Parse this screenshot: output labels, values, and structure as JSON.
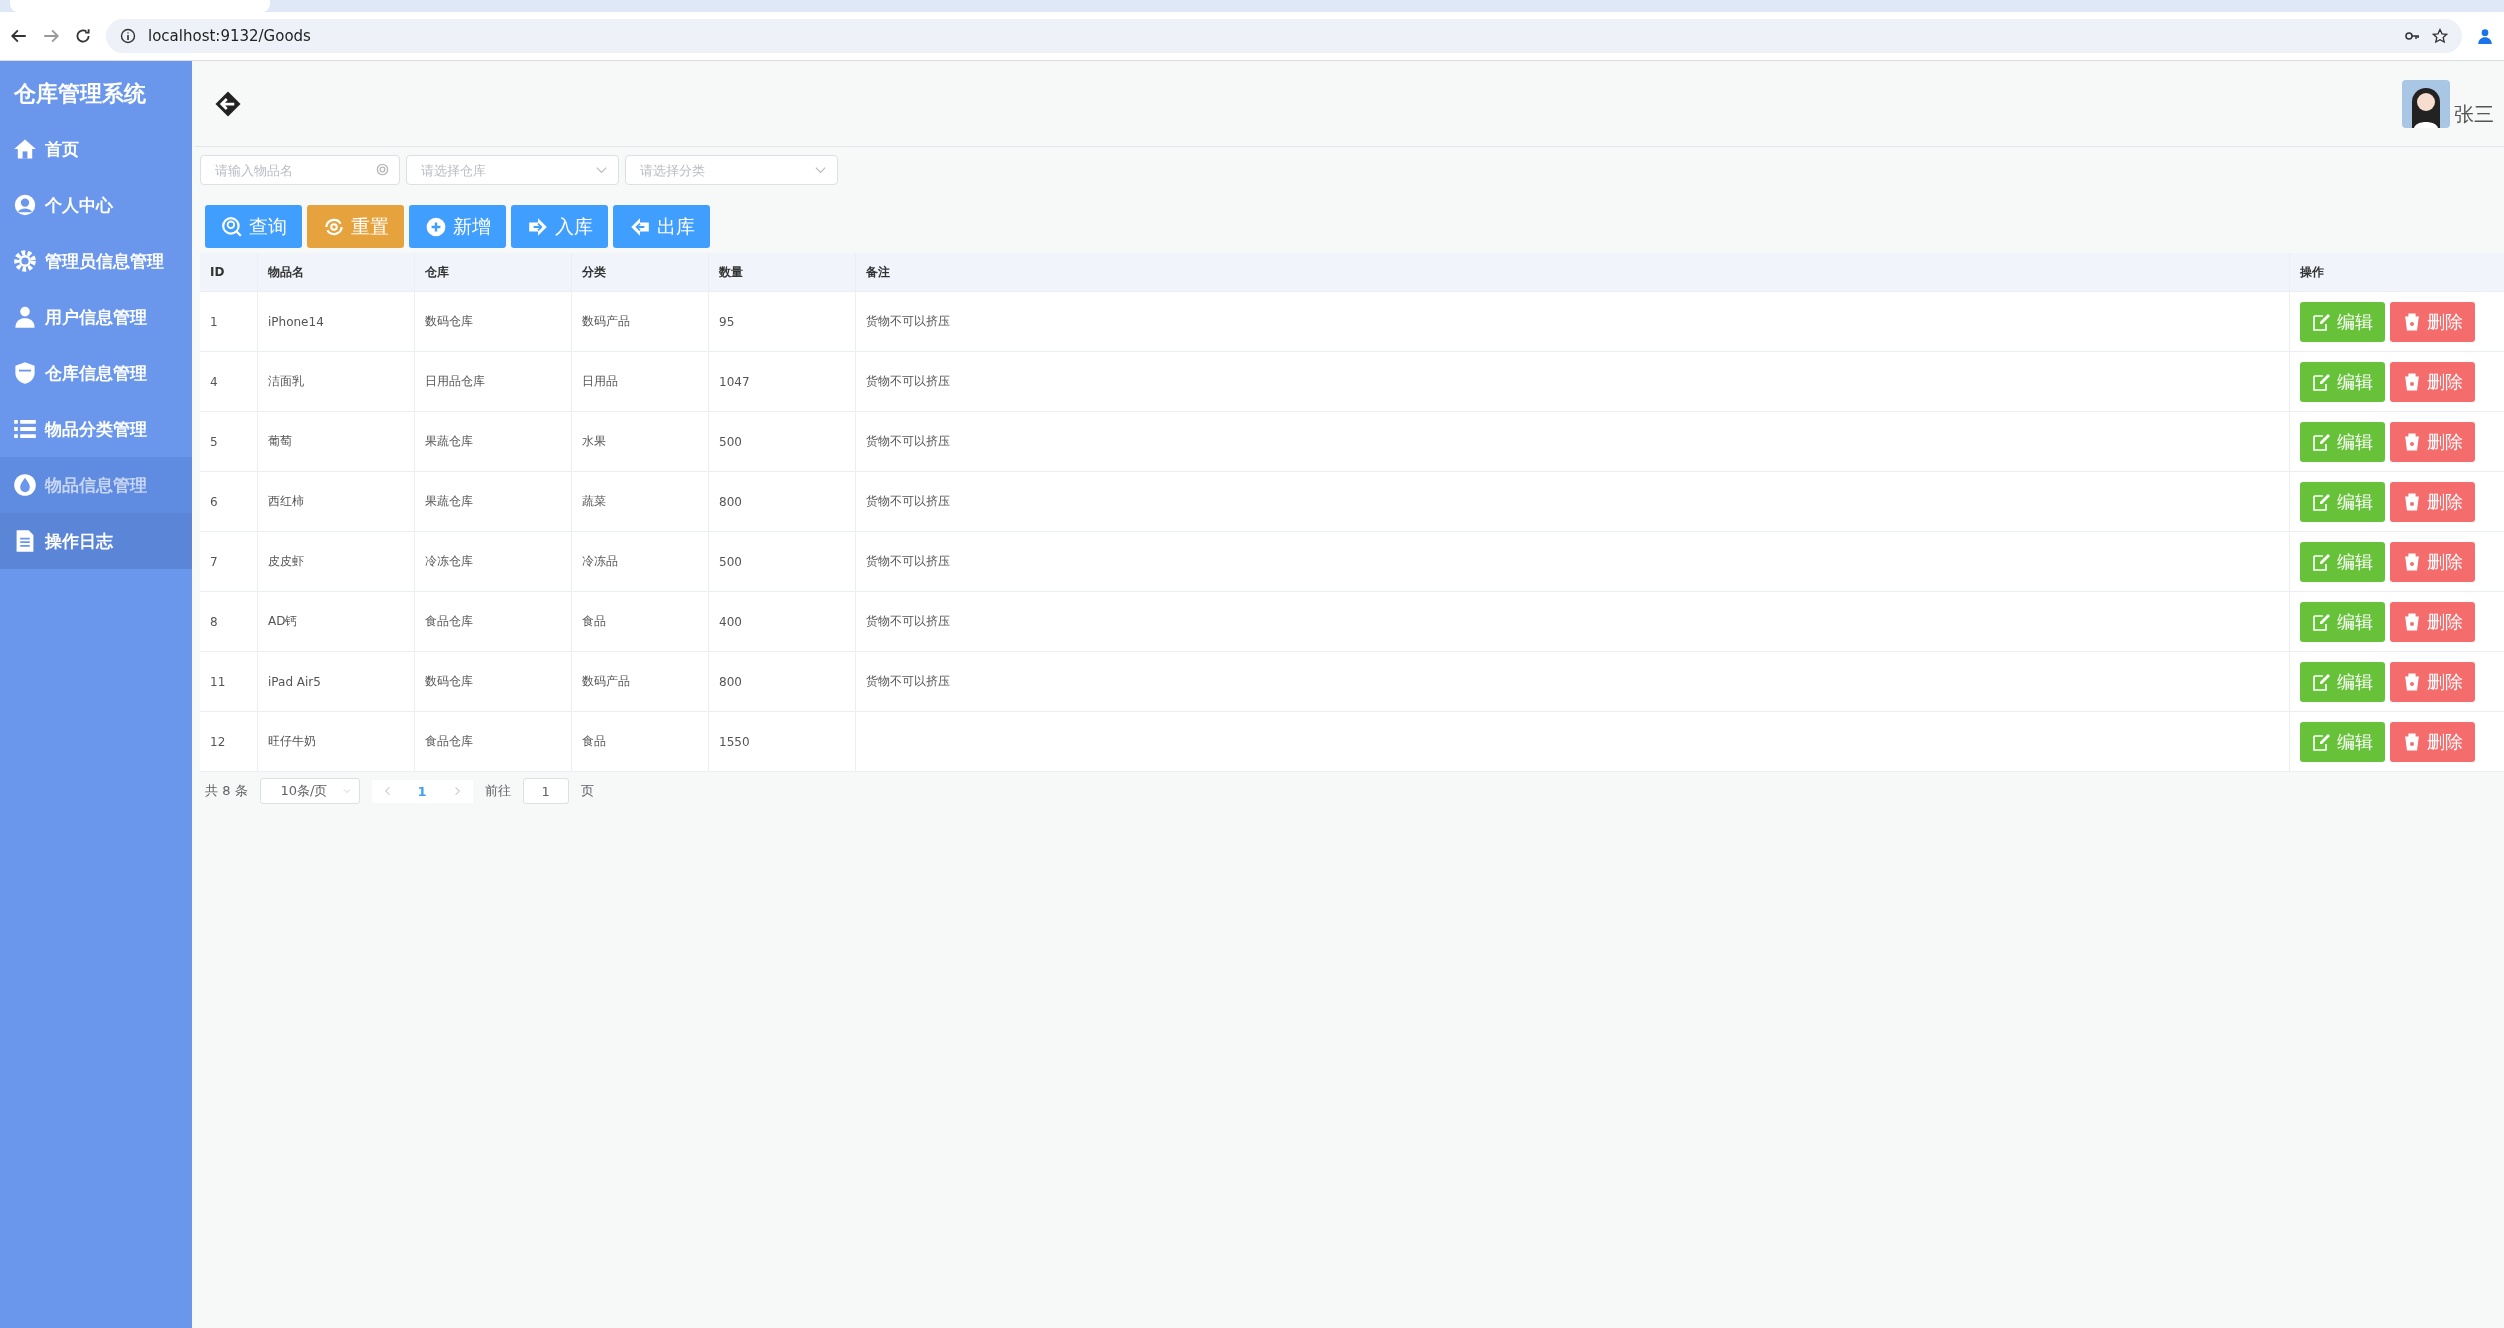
{
  "browser": {
    "url": "localhost:9132/Goods"
  },
  "sidebar": {
    "title": "仓库管理系统",
    "items": [
      {
        "label": "首页",
        "selected": false,
        "hovered": false
      },
      {
        "label": "个人中心",
        "selected": false,
        "hovered": false
      },
      {
        "label": "管理员信息管理",
        "selected": false,
        "hovered": false
      },
      {
        "label": "用户信息管理",
        "selected": false,
        "hovered": false
      },
      {
        "label": "仓库信息管理",
        "selected": false,
        "hovered": false
      },
      {
        "label": "物品分类管理",
        "selected": false,
        "hovered": false
      },
      {
        "label": "物品信息管理",
        "selected": true,
        "hovered": false
      },
      {
        "label": "操作日志",
        "selected": false,
        "hovered": true
      }
    ]
  },
  "header": {
    "user_name": "张三"
  },
  "filters": [
    {
      "kind": "search",
      "placeholder": "请输入物品名"
    },
    {
      "kind": "select",
      "placeholder": "请选择仓库"
    },
    {
      "kind": "select",
      "placeholder": "请选择分类"
    }
  ],
  "toolbar": [
    {
      "label": "查询",
      "kind": "search",
      "color": "#409eff"
    },
    {
      "label": "重置",
      "kind": "reset",
      "color": "#e6a23c"
    },
    {
      "label": "新增",
      "kind": "add",
      "color": "#409eff"
    },
    {
      "label": "入库",
      "kind": "in",
      "color": "#409eff"
    },
    {
      "label": "出库",
      "kind": "out",
      "color": "#409eff"
    }
  ],
  "table": {
    "columns": [
      "ID",
      "物品名",
      "仓库",
      "分类",
      "数量",
      "备注",
      "操作"
    ],
    "rows": [
      {
        "cells": [
          "1",
          "iPhone14",
          "数码仓库",
          "数码产品",
          "95",
          "货物不可以挤压"
        ],
        "actions": [
          "编辑",
          "删除"
        ]
      },
      {
        "cells": [
          "4",
          "洁面乳",
          "日用品仓库",
          "日用品",
          "1047",
          "货物不可以挤压"
        ],
        "actions": [
          "编辑",
          "删除"
        ]
      },
      {
        "cells": [
          "5",
          "葡萄",
          "果蔬仓库",
          "水果",
          "500",
          "货物不可以挤压"
        ],
        "actions": [
          "编辑",
          "删除"
        ]
      },
      {
        "cells": [
          "6",
          "西红柿",
          "果蔬仓库",
          "蔬菜",
          "800",
          "货物不可以挤压"
        ],
        "actions": [
          "编辑",
          "删除"
        ]
      },
      {
        "cells": [
          "7",
          "皮皮虾",
          "冷冻仓库",
          "冷冻品",
          "500",
          "货物不可以挤压"
        ],
        "actions": [
          "编辑",
          "删除"
        ]
      },
      {
        "cells": [
          "8",
          "AD钙",
          "食品仓库",
          "食品",
          "400",
          "货物不可以挤压"
        ],
        "actions": [
          "编辑",
          "删除"
        ]
      },
      {
        "cells": [
          "11",
          "iPad Air5",
          "数码仓库",
          "数码产品",
          "800",
          "货物不可以挤压"
        ],
        "actions": [
          "编辑",
          "删除"
        ]
      },
      {
        "cells": [
          "12",
          "旺仔牛奶",
          "食品仓库",
          "食品",
          "1550",
          ""
        ],
        "actions": [
          "编辑",
          "删除"
        ]
      }
    ]
  },
  "pagination": {
    "total": "共 8 条",
    "page_size": "10条/页",
    "pages": [
      {
        "label": "1",
        "selected": true
      }
    ],
    "goto_label": "前往",
    "goto_value": "1",
    "goto_suffix": "页"
  }
}
